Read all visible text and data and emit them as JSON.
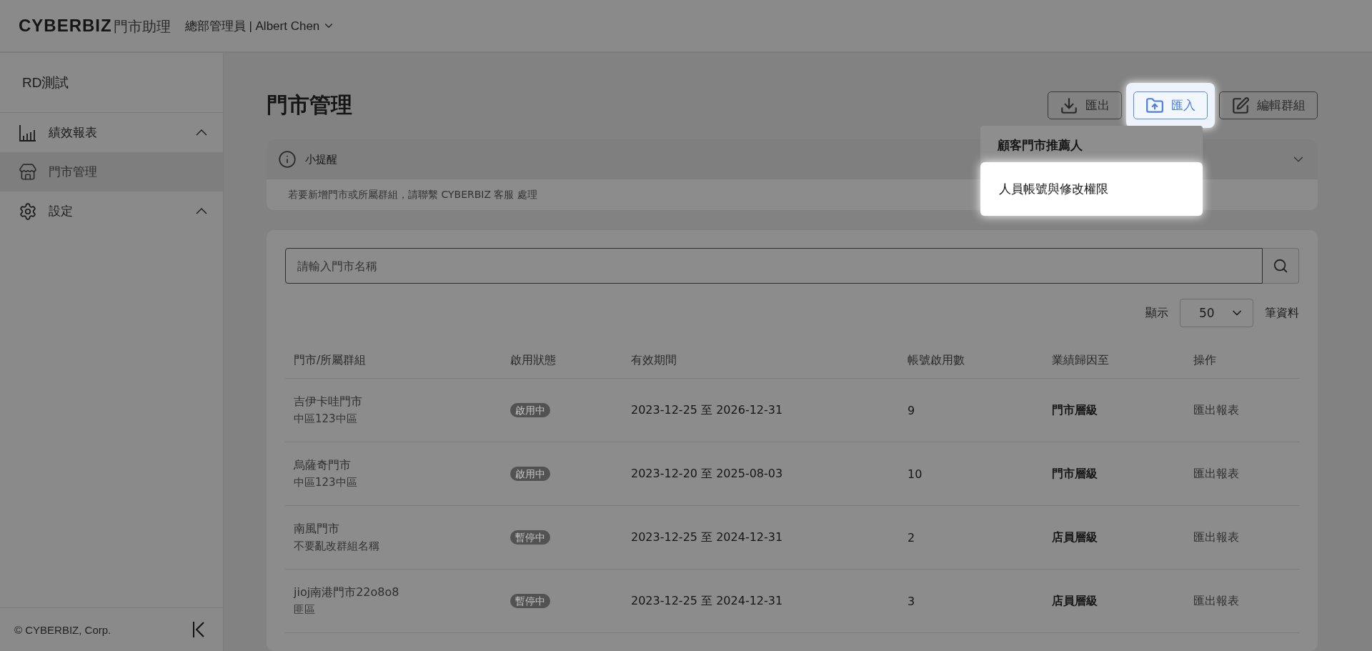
{
  "header": {
    "logo": "CYBERBIZ",
    "logo_suffix": "門市助理",
    "user": "總部管理員 | Albert Chen"
  },
  "sidebar": {
    "store": "RD測試",
    "items": [
      {
        "label": "績效報表",
        "kind": "chart",
        "selected": false,
        "expanded": true
      },
      {
        "label": "門市管理",
        "kind": "store",
        "selected": true
      },
      {
        "label": "設定",
        "kind": "gear",
        "selected": false,
        "expanded": true
      }
    ],
    "footer": "© CYBERBIZ, Corp."
  },
  "page": {
    "title": "門市管理",
    "buttons": [
      {
        "label": "匯出",
        "kind": "download",
        "highlighted": false
      },
      {
        "label": "匯入",
        "kind": "folder-upload",
        "highlighted": true
      },
      {
        "label": "編輯群組",
        "kind": "edit",
        "highlighted": false
      }
    ],
    "menu": [
      {
        "label": "顧客門市推薦人",
        "highlighted": false
      },
      {
        "label": "人員帳號與修改權限",
        "highlighted": true
      }
    ]
  },
  "tip": {
    "title": "小提醒",
    "text": "若要新增門市或所屬群組，請聯繫 CYBERBIZ 客服 處理"
  },
  "search": {
    "placeholder": "請輸入門市名稱"
  },
  "page_size": {
    "label": "顯示",
    "value": "50",
    "suffix": "筆資料"
  },
  "table": {
    "columns": [
      "門市/所屬群組",
      "啟用狀態",
      "有效期間",
      "帳號啟用數",
      "業績歸因至",
      "操作"
    ],
    "rows": [
      {
        "store": "吉伊卡哇門市",
        "group": "中區123中區",
        "status": "啟用中",
        "period": "2023-12-25 至 2026-12-31",
        "accounts": "9",
        "attribution": "門市層級",
        "action": "匯出報表"
      },
      {
        "store": "烏薩奇門市",
        "group": "中區123中區",
        "status": "啟用中",
        "period": "2023-12-20 至 2025-08-03",
        "accounts": "10",
        "attribution": "門市層級",
        "action": "匯出報表"
      },
      {
        "store": "南風門市",
        "group": "不要亂改群組名稱",
        "status": "暫停中",
        "period": "2023-12-25 至 2024-12-31",
        "accounts": "2",
        "attribution": "店員層級",
        "action": "匯出報表"
      },
      {
        "store": "jioj南港門市22o8o8",
        "group": "匪區",
        "status": "暫停中",
        "period": "2023-12-25 至 2024-12-31",
        "accounts": "3",
        "attribution": "店員層級",
        "action": "匯出報表"
      }
    ]
  }
}
